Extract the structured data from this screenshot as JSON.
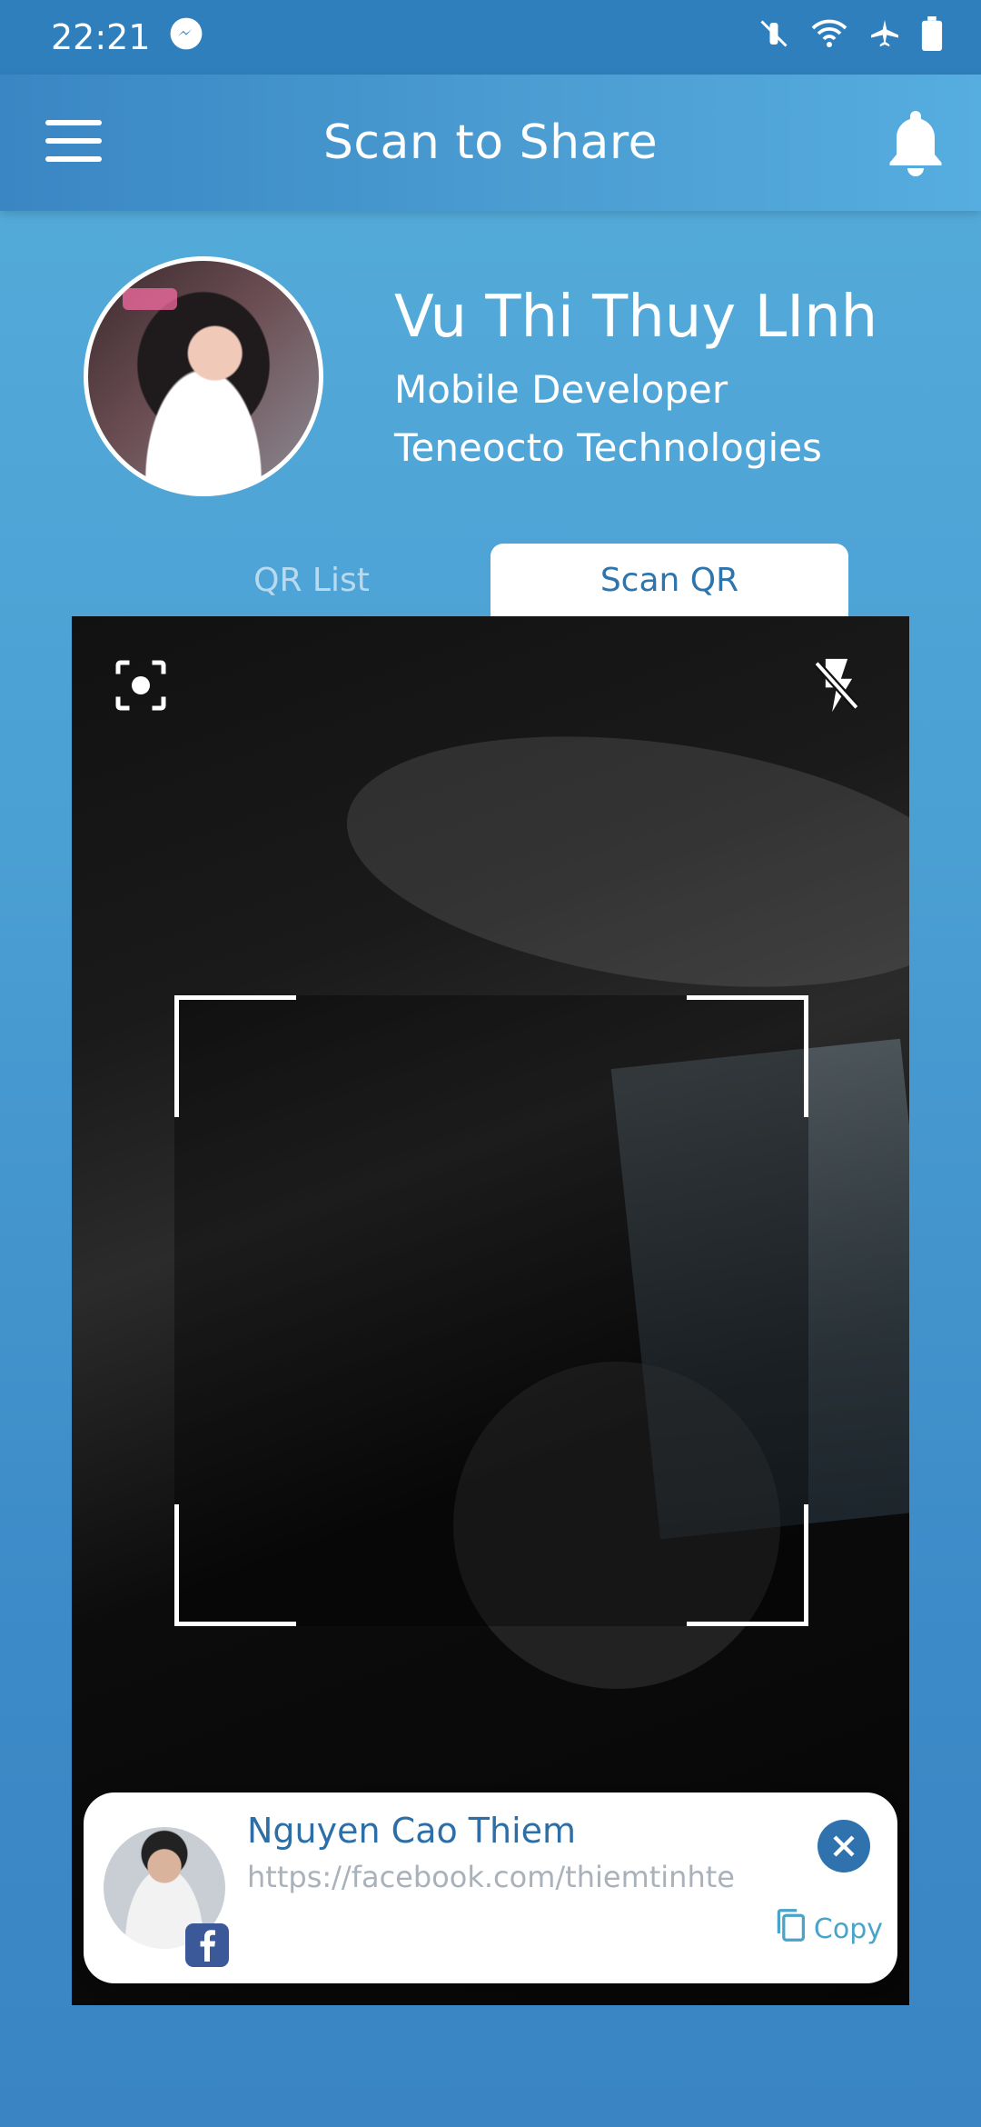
{
  "status_bar": {
    "time": "22:21",
    "icons": [
      "messenger-icon",
      "mute-icon",
      "wifi-icon",
      "airplane-icon",
      "battery-icon"
    ]
  },
  "header": {
    "title": "Scan to Share",
    "icons": [
      "menu-icon",
      "bell-icon"
    ]
  },
  "profile": {
    "name": "Vu Thi Thuy LInh",
    "role": "Mobile Developer",
    "company": "Teneocto Technologies"
  },
  "tabs": [
    {
      "label": "QR List",
      "active": false
    },
    {
      "label": "Scan QR",
      "active": true
    }
  ],
  "camera": {
    "icons": [
      "focus-icon",
      "flash-off-icon"
    ]
  },
  "result": {
    "name": "Nguyen Cao Thiem",
    "url": "https://facebook.com/thiemtinhte",
    "copy_label": "Copy",
    "icons": [
      "facebook-icon",
      "close-icon",
      "copy-icon"
    ]
  },
  "colors": {
    "status_bar": "#2f7fbd",
    "accent": "#2f72ad",
    "tab_active_text": "#2f75ad",
    "facebook": "#3b5998"
  }
}
